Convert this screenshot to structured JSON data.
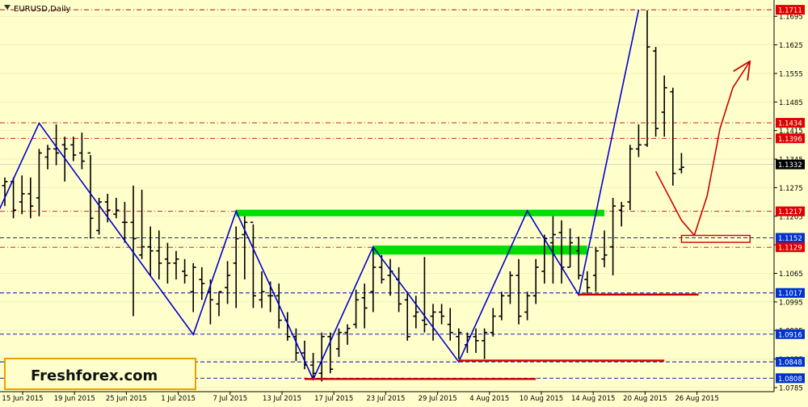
{
  "window": {
    "title": "EURUSD,Daily"
  },
  "watermark": {
    "text": "Freshforex.com"
  },
  "colors": {
    "background": "#FFFFCC",
    "bars": "#000000",
    "zigzag": "#0000CC",
    "resistance": "#CC0000",
    "support": "#0000AA",
    "zone_fill": "#00DD00",
    "price_tag_red": "#E00000",
    "price_tag_blue": "#0033CC",
    "current_tag": "#000000",
    "arrow": "#CC0000"
  },
  "chart_data": {
    "type": "ohlc",
    "symbol": "EURUSD",
    "timeframe": "Daily",
    "ylim": [
      1.0775,
      1.1735
    ],
    "y_ticks": [
      "1.1695",
      "1.1625",
      "1.1555",
      "1.1485",
      "1.1415",
      "1.1345",
      "1.1275",
      "1.1205",
      "1.1135",
      "1.1065",
      "1.0995",
      "1.0925",
      "1.0855",
      "1.0785"
    ],
    "x_ticks": [
      "15 Jun 2015",
      "19 Jun 2015",
      "25 Jun 2015",
      "1 Jul 2015",
      "7 Jul 2015",
      "13 Jul 2015",
      "17 Jul 2015",
      "23 Jul 2015",
      "29 Jul 2015",
      "4 Aug 2015",
      "10 Aug 2015",
      "14 Aug 2015",
      "20 Aug 2015",
      "26 Aug 2015"
    ],
    "last_price": "1.1332",
    "bars": [
      {
        "o": 1.128,
        "h": 1.13,
        "l": 1.123,
        "c": 1.129
      },
      {
        "o": 1.129,
        "h": 1.13,
        "l": 1.12,
        "c": 1.122
      },
      {
        "o": 1.124,
        "h": 1.1305,
        "l": 1.121,
        "c": 1.126
      },
      {
        "o": 1.126,
        "h": 1.13,
        "l": 1.12,
        "c": 1.123
      },
      {
        "o": 1.125,
        "h": 1.137,
        "l": 1.1205,
        "c": 1.136
      },
      {
        "o": 1.135,
        "h": 1.138,
        "l": 1.132,
        "c": 1.137
      },
      {
        "o": 1.137,
        "h": 1.143,
        "l": 1.133,
        "c": 1.136
      },
      {
        "o": 1.138,
        "h": 1.14,
        "l": 1.129,
        "c": 1.137
      },
      {
        "o": 1.138,
        "h": 1.14,
        "l": 1.134,
        "c": 1.1355
      },
      {
        "o": 1.136,
        "h": 1.141,
        "l": 1.132,
        "c": 1.134
      },
      {
        "o": 1.136,
        "h": 1.1355,
        "l": 1.115,
        "c": 1.12
      },
      {
        "o": 1.117,
        "h": 1.125,
        "l": 1.116,
        "c": 1.124
      },
      {
        "o": 1.124,
        "h": 1.126,
        "l": 1.119,
        "c": 1.122
      },
      {
        "o": 1.121,
        "h": 1.125,
        "l": 1.12,
        "c": 1.122
      },
      {
        "o": 1.119,
        "h": 1.124,
        "l": 1.114,
        "c": 1.119
      },
      {
        "o": 1.119,
        "h": 1.128,
        "l": 1.096,
        "c": 1.115
      },
      {
        "o": 1.111,
        "h": 1.127,
        "l": 1.11,
        "c": 1.113
      },
      {
        "o": 1.113,
        "h": 1.118,
        "l": 1.106,
        "c": 1.112
      },
      {
        "o": 1.112,
        "h": 1.117,
        "l": 1.105,
        "c": 1.109
      },
      {
        "o": 1.11,
        "h": 1.114,
        "l": 1.104,
        "c": 1.109
      },
      {
        "o": 1.109,
        "h": 1.112,
        "l": 1.105,
        "c": 1.11
      },
      {
        "o": 1.107,
        "h": 1.11,
        "l": 1.104,
        "c": 1.106
      },
      {
        "o": 1.102,
        "h": 1.109,
        "l": 1.097,
        "c": 1.108
      },
      {
        "o": 1.105,
        "h": 1.108,
        "l": 1.1,
        "c": 1.104
      },
      {
        "o": 1.102,
        "h": 1.105,
        "l": 1.094,
        "c": 1.1
      },
      {
        "o": 1.099,
        "h": 1.102,
        "l": 1.096,
        "c": 1.102
      },
      {
        "o": 1.103,
        "h": 1.1095,
        "l": 1.099,
        "c": 1.106
      },
      {
        "o": 1.109,
        "h": 1.118,
        "l": 1.098,
        "c": 1.115
      },
      {
        "o": 1.116,
        "h": 1.1205,
        "l": 1.105,
        "c": 1.119
      },
      {
        "o": 1.119,
        "h": 1.1185,
        "l": 1.098,
        "c": 1.101
      },
      {
        "o": 1.1,
        "h": 1.107,
        "l": 1.098,
        "c": 1.102
      },
      {
        "o": 1.101,
        "h": 1.1045,
        "l": 1.097,
        "c": 1.101
      },
      {
        "o": 1.101,
        "h": 1.104,
        "l": 1.093,
        "c": 1.095
      },
      {
        "o": 1.095,
        "h": 1.097,
        "l": 1.09,
        "c": 1.091
      },
      {
        "o": 1.091,
        "h": 1.093,
        "l": 1.085,
        "c": 1.087
      },
      {
        "o": 1.087,
        "h": 1.09,
        "l": 1.083,
        "c": 1.084
      },
      {
        "o": 1.084,
        "h": 1.087,
        "l": 1.081,
        "c": 1.082
      },
      {
        "o": 1.082,
        "h": 1.092,
        "l": 1.08,
        "c": 1.091
      },
      {
        "o": 1.091,
        "h": 1.092,
        "l": 1.082,
        "c": 1.083
      },
      {
        "o": 1.088,
        "h": 1.093,
        "l": 1.086,
        "c": 1.092
      },
      {
        "o": 1.092,
        "h": 1.094,
        "l": 1.089,
        "c": 1.093
      },
      {
        "o": 1.094,
        "h": 1.1025,
        "l": 1.093,
        "c": 1.1
      },
      {
        "o": 1.1005,
        "h": 1.104,
        "l": 1.093,
        "c": 1.098
      },
      {
        "o": 1.102,
        "h": 1.1125,
        "l": 1.097,
        "c": 1.108
      },
      {
        "o": 1.108,
        "h": 1.111,
        "l": 1.104,
        "c": 1.105
      },
      {
        "o": 1.106,
        "h": 1.11,
        "l": 1.101,
        "c": 1.107
      },
      {
        "o": 1.105,
        "h": 1.108,
        "l": 1.097,
        "c": 1.099
      },
      {
        "o": 1.1,
        "h": 1.102,
        "l": 1.09,
        "c": 1.091
      },
      {
        "o": 1.096,
        "h": 1.101,
        "l": 1.093,
        "c": 1.097
      },
      {
        "o": 1.095,
        "h": 1.1105,
        "l": 1.092,
        "c": 1.094
      },
      {
        "o": 1.096,
        "h": 1.099,
        "l": 1.09,
        "c": 1.097
      },
      {
        "o": 1.097,
        "h": 1.099,
        "l": 1.094,
        "c": 1.096
      },
      {
        "o": 1.094,
        "h": 1.098,
        "l": 1.09,
        "c": 1.092
      },
      {
        "o": 1.091,
        "h": 1.093,
        "l": 1.0855,
        "c": 1.092
      },
      {
        "o": 1.089,
        "h": 1.092,
        "l": 1.087,
        "c": 1.091
      },
      {
        "o": 1.091,
        "h": 1.093,
        "l": 1.087,
        "c": 1.09
      },
      {
        "o": 1.09,
        "h": 1.093,
        "l": 1.0855,
        "c": 1.092
      },
      {
        "o": 1.092,
        "h": 1.098,
        "l": 1.091,
        "c": 1.096
      },
      {
        "o": 1.096,
        "h": 1.102,
        "l": 1.095,
        "c": 1.101
      },
      {
        "o": 1.101,
        "h": 1.107,
        "l": 1.099,
        "c": 1.106
      },
      {
        "o": 1.106,
        "h": 1.11,
        "l": 1.094,
        "c": 1.096
      },
      {
        "o": 1.097,
        "h": 1.102,
        "l": 1.095,
        "c": 1.101
      },
      {
        "o": 1.101,
        "h": 1.11,
        "l": 1.099,
        "c": 1.108
      },
      {
        "o": 1.107,
        "h": 1.116,
        "l": 1.104,
        "c": 1.115
      },
      {
        "o": 1.114,
        "h": 1.1205,
        "l": 1.104,
        "c": 1.116
      },
      {
        "o": 1.1165,
        "h": 1.1195,
        "l": 1.104,
        "c": 1.108
      },
      {
        "o": 1.108,
        "h": 1.1175,
        "l": 1.108,
        "c": 1.114
      },
      {
        "o": 1.112,
        "h": 1.1155,
        "l": 1.105,
        "c": 1.106
      },
      {
        "o": 1.105,
        "h": 1.107,
        "l": 1.1015,
        "c": 1.103
      },
      {
        "o": 1.106,
        "h": 1.113,
        "l": 1.102,
        "c": 1.112
      },
      {
        "o": 1.11,
        "h": 1.117,
        "l": 1.108,
        "c": 1.111
      },
      {
        "o": 1.113,
        "h": 1.125,
        "l": 1.106,
        "c": 1.123
      },
      {
        "o": 1.122,
        "h": 1.124,
        "l": 1.118,
        "c": 1.123
      },
      {
        "o": 1.124,
        "h": 1.138,
        "l": 1.122,
        "c": 1.137
      },
      {
        "o": 1.137,
        "h": 1.143,
        "l": 1.135,
        "c": 1.138
      },
      {
        "o": 1.138,
        "h": 1.171,
        "l": 1.1375,
        "c": 1.162
      },
      {
        "o": 1.161,
        "h": 1.162,
        "l": 1.14,
        "c": 1.142
      },
      {
        "o": 1.146,
        "h": 1.155,
        "l": 1.14,
        "c": 1.152
      },
      {
        "o": 1.151,
        "h": 1.152,
        "l": 1.128,
        "c": 1.131
      },
      {
        "o": 1.132,
        "h": 1.136,
        "l": 1.131,
        "c": 1.1325
      }
    ],
    "levels": [
      {
        "label": "1.1711",
        "price": 1.1711,
        "kind": "resistance"
      },
      {
        "label": "1.1434",
        "price": 1.1434,
        "kind": "resistance"
      },
      {
        "label": "1.1396",
        "price": 1.1396,
        "kind": "resistance"
      },
      {
        "label": "1.1217",
        "price": 1.1217,
        "kind": "resistance"
      },
      {
        "label": "1.1152",
        "price": 1.1152,
        "kind": "support"
      },
      {
        "label": "1.1129",
        "price": 1.1129,
        "kind": "resistance"
      },
      {
        "label": "1.1017",
        "price": 1.1017,
        "kind": "support"
      },
      {
        "label": "1.0916",
        "price": 1.0916,
        "kind": "support"
      },
      {
        "label": "1.0848",
        "price": 1.0848,
        "kind": "support"
      },
      {
        "label": "1.0808",
        "price": 1.0808,
        "kind": "support"
      }
    ],
    "zigzag": [
      {
        "bar": -1,
        "price": 1.1205
      },
      {
        "bar": 4,
        "price": 1.1433
      },
      {
        "bar": 22,
        "price": 1.0915
      },
      {
        "bar": 27,
        "price": 1.1217
      },
      {
        "bar": 36,
        "price": 1.0805
      },
      {
        "bar": 43,
        "price": 1.113
      },
      {
        "bar": 53,
        "price": 1.0848
      },
      {
        "bar": 61,
        "price": 1.1218
      },
      {
        "bar": 67,
        "price": 1.1012
      },
      {
        "bar": 74,
        "price": 1.1711
      }
    ],
    "zones": [
      {
        "from_bar": 27,
        "to_bar": 70,
        "top": 1.1221,
        "bottom": 1.1205
      },
      {
        "from_bar": 43,
        "to_bar": 68,
        "top": 1.1133,
        "bottom": 1.1111
      }
    ],
    "support_lines": [
      {
        "from_bar": 67,
        "to_bar": 81,
        "price": 1.1013
      },
      {
        "from_bar": 53,
        "to_bar": 77,
        "price": 1.0851
      },
      {
        "from_bar": 35,
        "to_bar": 62,
        "price": 1.0806
      }
    ],
    "forecast_box": {
      "from_bar": 79,
      "to_bar": 87,
      "top": 1.1158,
      "bottom": 1.1141
    },
    "forecast_path": [
      {
        "bar": 76,
        "price": 1.1315
      },
      {
        "bar": 79,
        "price": 1.1195
      },
      {
        "bar": 80.5,
        "price": 1.1158
      },
      {
        "bar": 82,
        "price": 1.1255
      },
      {
        "bar": 83.5,
        "price": 1.142
      },
      {
        "bar": 85,
        "price": 1.152
      },
      {
        "bar": 87,
        "price": 1.1585
      }
    ]
  }
}
